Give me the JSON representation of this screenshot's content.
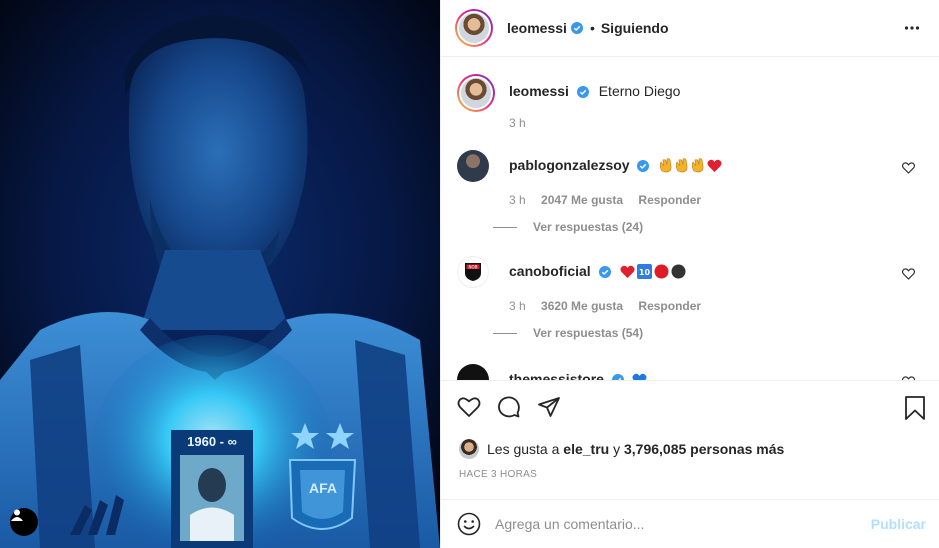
{
  "header": {
    "username": "leomessi",
    "dot": "•",
    "follow_label": "Siguiendo"
  },
  "caption": {
    "username": "leomessi",
    "text": "Eterno Diego",
    "time": "3 h"
  },
  "comments": [
    {
      "username": "pablogonzalezsoy",
      "emojis": [
        "clap",
        "clap",
        "clap",
        "red-heart"
      ],
      "time": "3 h",
      "likes": "2047 Me gusta",
      "reply": "Responder",
      "view_replies": "Ver respuestas (24)"
    },
    {
      "username": "canoboficial",
      "emojis": [
        "red-heart",
        "keycap-10",
        "red-circle",
        "black-circle"
      ],
      "time": "3 h",
      "likes": "3620 Me gusta",
      "reply": "Responder",
      "view_replies": "Ver respuestas (54)"
    },
    {
      "username": "themessistore",
      "emojis": [
        "blue-heart"
      ]
    }
  ],
  "media": {
    "jersey_text": "1960 - ∞",
    "crest_text": "AFA"
  },
  "likes": {
    "prefix": "Les gusta a",
    "user": "ele_tru",
    "middle": "y",
    "count": "3,796,085 personas más"
  },
  "time_ago": "HACE 3 HORAS",
  "add_comment": {
    "placeholder": "Agrega un comentario...",
    "publish": "Publicar"
  },
  "colors": {
    "verified": "#3897f0",
    "publish_disabled": "#b2dffc",
    "muted": "#8e8e8e"
  }
}
